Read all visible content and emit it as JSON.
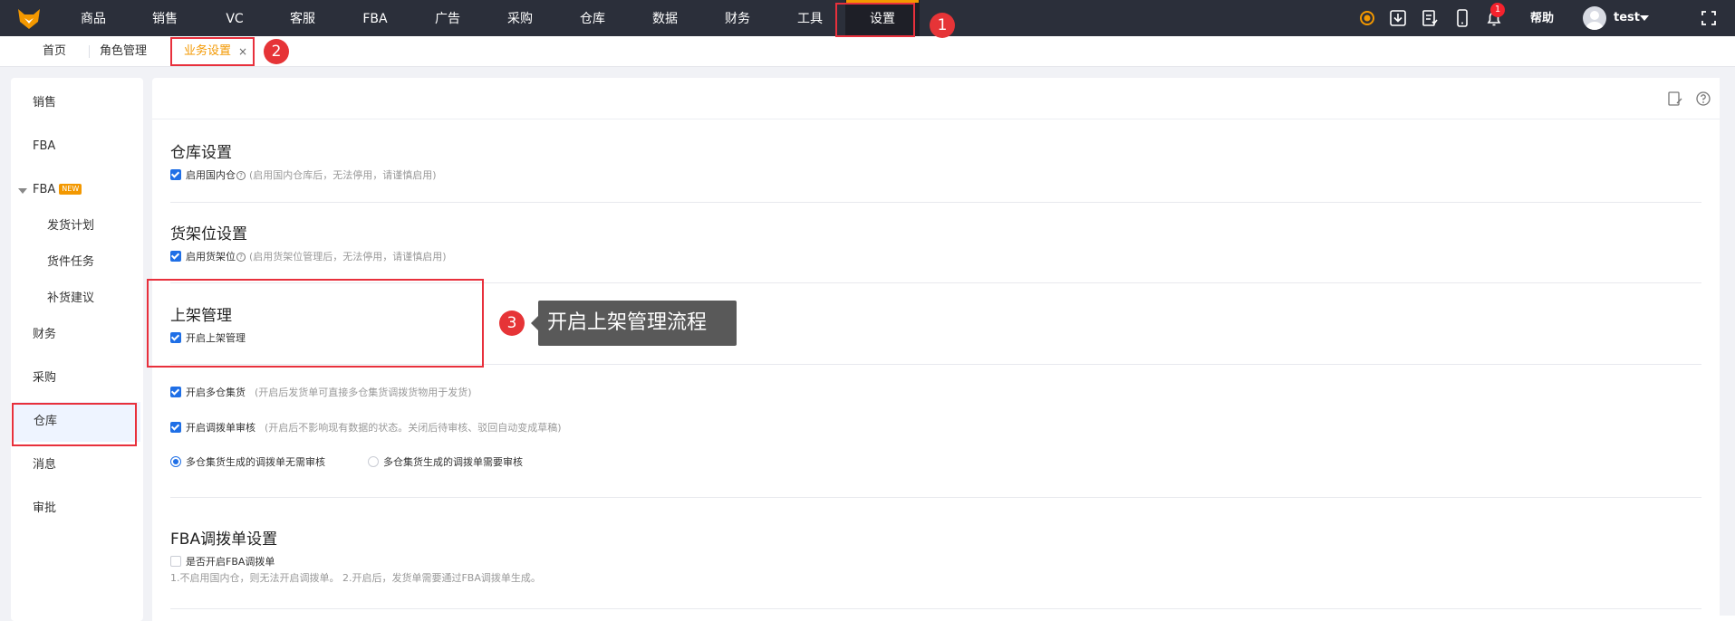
{
  "nav": {
    "items": [
      "商品",
      "销售",
      "VC",
      "客服",
      "FBA",
      "广告",
      "采购",
      "仓库",
      "数据",
      "财务",
      "工具",
      "设置"
    ],
    "help": "帮助",
    "user": "test",
    "notification_count": "1"
  },
  "tabs": {
    "home": "首页",
    "role": "角色管理",
    "business": "业务设置",
    "close": "×"
  },
  "markers": [
    "1",
    "2",
    "3"
  ],
  "tooltip": "开启上架管理流程",
  "sidebar": {
    "items": [
      "销售",
      "FBA",
      "FBA",
      "发货计划",
      "货件任务",
      "补货建议",
      "财务",
      "采购",
      "仓库",
      "消息",
      "审批"
    ],
    "new_tag": "NEW"
  },
  "warehouse": {
    "title": "仓库设置",
    "enable_domestic": "启用国内仓",
    "enable_domestic_hint": "(启用国内仓库后，无法停用，请谨慎启用)"
  },
  "shelf": {
    "title": "货架位设置",
    "enable_shelf": "启用货架位",
    "enable_shelf_hint": "(启用货架位管理后，无法停用，请谨慎启用)"
  },
  "putaway": {
    "title": "上架管理",
    "enable_putaway": "开启上架管理"
  },
  "consolidation": {
    "multi_warehouse": "开启多仓集货",
    "multi_warehouse_hint": "(开启后发货单可直接多仓集货调拨货物用于发货)",
    "transfer_review": "开启调拨单审核",
    "transfer_review_hint": "(开启后不影响现有数据的状态。关闭后待审核、驳回自动变成草稿)",
    "radio_no_review": "多仓集货生成的调拨单无需审核",
    "radio_need_review": "多仓集货生成的调拨单需要审核"
  },
  "fba_transfer": {
    "title": "FBA调拨单设置",
    "enable": "是否开启FBA调拨单",
    "note": "1.不启用国内仓，则无法开启调拨单。 2.开启后，发货单需要通过FBA调拨单生成。"
  },
  "colors": {
    "nav_bg": "#2b2f3a",
    "accent_orange": "#f39800",
    "highlight_red": "#e8303c",
    "checkbox_blue": "#1f6fe6",
    "sidebar_active_bg": "#eef4ff"
  }
}
